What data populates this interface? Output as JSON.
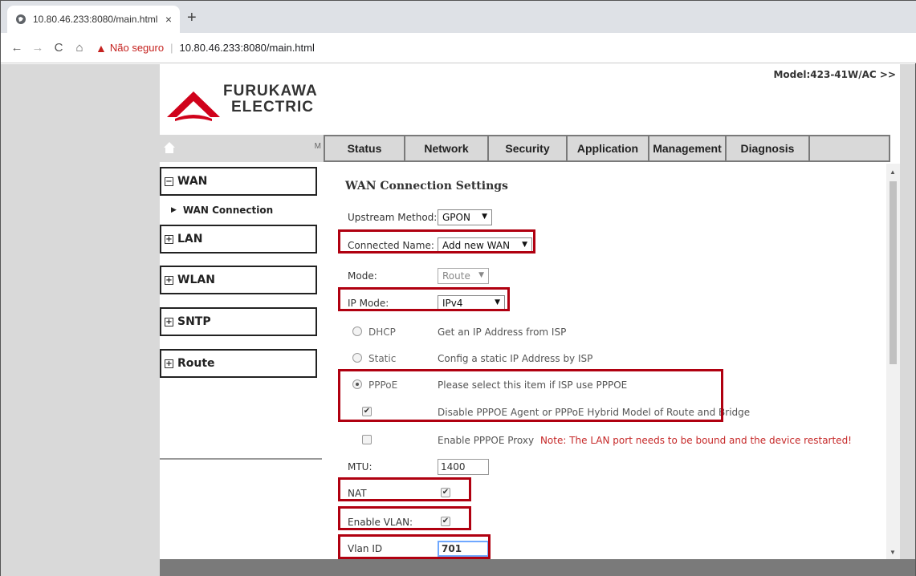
{
  "browser": {
    "tab_title": "10.80.46.233:8080/main.html",
    "tab_close": "×",
    "new_tab": "+",
    "back": "←",
    "forward": "→",
    "reload": "C",
    "home": "⌂",
    "not_secure": "Não seguro",
    "separator": "|",
    "url": "10.80.46.233:8080/main.html"
  },
  "header": {
    "logo_line1": "FURUKAWA",
    "logo_line2": "ELECTRIC",
    "model": "Model:423-41W/AC >>",
    "home_bar_text": "M",
    "brand_color": "#d0021b"
  },
  "menu": {
    "items": [
      "Status",
      "Network",
      "Security",
      "Application",
      "Management",
      "Diagnosis",
      ""
    ]
  },
  "sidebar": {
    "wan": "WAN",
    "wan_toggle": "−",
    "wan_connection": "WAN Connection",
    "sub_arrow": "▶",
    "lan": "LAN",
    "lan_toggle": "+",
    "wlan": "WLAN",
    "wlan_toggle": "+",
    "sntp": "SNTP",
    "sntp_toggle": "+",
    "route": "Route",
    "route_toggle": "+"
  },
  "form": {
    "title": "WAN Connection Settings",
    "upstream_label": "Upstream Method:",
    "upstream_value": "GPON",
    "connected_label": "Connected Name:",
    "connected_value": "Add new WAN",
    "mode_label": "Mode:",
    "mode_value": "Route",
    "ipmode_label": "IP Mode:",
    "ipmode_value": "IPv4",
    "dhcp_label": "DHCP",
    "dhcp_desc": "Get an IP Address from ISP",
    "static_label": "Static",
    "static_desc": "Config a static IP Address by ISP",
    "pppoe_label": "PPPoE",
    "pppoe_desc": "Please select this item if ISP use PPPOE",
    "disable_agent_desc": "Disable PPPOE Agent or PPPoE Hybrid Model of Route and Bridge",
    "enable_proxy_desc": "Enable PPPOE Proxy",
    "proxy_note": "Note: The LAN port needs to be bound and the device restarted!",
    "mtu_label": "MTU:",
    "mtu_value": "1400",
    "nat_label": "NAT",
    "vlan_enable_label": "Enable VLAN:",
    "vlan_id_label": "Vlan ID",
    "vlan_id_value": "701",
    "arrow": "▼",
    "check_mark": "✔",
    "scroll_up": "▲",
    "scroll_down": "▼"
  },
  "colors": {
    "highlight_box": "#b00010",
    "note": "#c62828"
  }
}
